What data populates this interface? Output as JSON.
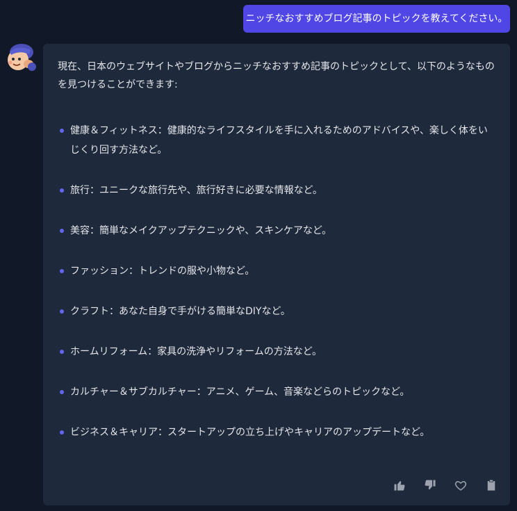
{
  "user_message": {
    "text": "ニッチなおすすめブログ記事のトピックを教えてください。"
  },
  "assistant_message": {
    "intro": "現在、日本のウェブサイトやブログからニッチなおすすめ記事のトピックとして、以下のようなものを見つけることができます:",
    "topics": [
      "健康＆フィットネス：健康的なライフスタイルを手に入れるためのアドバイスや、楽しく体をいじくり回す方法など。",
      "旅行：ユニークな旅行先や、旅行好きに必要な情報など。",
      "美容：簡単なメイクアップテクニックや、スキンケアなど。",
      "ファッション：トレンドの服や小物など。",
      "クラフト：あなた自身で手がける簡単なDIYなど。",
      "ホームリフォーム：家具の洗浄やリフォームの方法など。",
      "カルチャー＆サブカルチャー：アニメ、ゲーム、音楽などらのトピックなど。",
      "ビジネス＆キャリア：スタートアップの立ち上げやキャリアのアップデートなど。"
    ]
  },
  "icons": {
    "avatar": "bot-avatar-icon",
    "like": "thumbs-up-icon",
    "dislike": "thumbs-down-icon",
    "favorite": "heart-icon",
    "copy": "clipboard-icon"
  },
  "colors": {
    "background": "#111827",
    "card": "#1e293b",
    "accent": "#4f46e5",
    "bullet": "#6366f1",
    "text": "#e5e7eb",
    "icon": "#9ca3af"
  }
}
